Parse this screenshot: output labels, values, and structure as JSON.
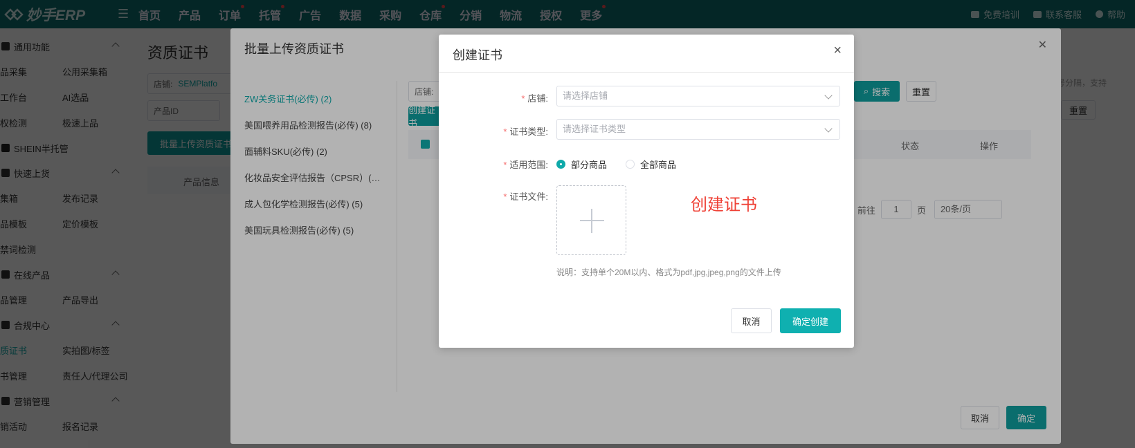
{
  "topbar": {
    "logo_text": "妙手ERP",
    "nav": [
      {
        "label": "首页",
        "dot": false
      },
      {
        "label": "产品",
        "dot": false
      },
      {
        "label": "订单",
        "dot": true
      },
      {
        "label": "托管",
        "dot": true
      },
      {
        "label": "广告",
        "dot": false
      },
      {
        "label": "数据",
        "dot": false
      },
      {
        "label": "采购",
        "dot": false
      },
      {
        "label": "仓库",
        "dot": true
      },
      {
        "label": "分销",
        "dot": false
      },
      {
        "label": "物流",
        "dot": false
      },
      {
        "label": "授权",
        "dot": false
      },
      {
        "label": "更多",
        "dot": true
      }
    ],
    "free_training": "免费培训",
    "contact_service": "联系客服",
    "help": "帮助"
  },
  "sidebar": {
    "general": "通用功能",
    "row1": [
      "品采集",
      "公用采集箱"
    ],
    "row2": [
      "工作台",
      "AI选品"
    ],
    "row3": [
      "权检测",
      "极速上品"
    ],
    "shein": "SHEIN半托管",
    "quick": "快速上货",
    "row4": [
      "集箱",
      "发布记录"
    ],
    "row5": [
      "品模板",
      "定价模板"
    ],
    "row6": [
      "禁词检测"
    ],
    "online": "在线产品",
    "row7": [
      "品管理",
      "产品导出"
    ],
    "compliance": "合规中心",
    "row8": [
      "质证书",
      "实拍图/标签"
    ],
    "row9": [
      "书管理",
      "责任人/代理公司"
    ],
    "marketing": "营销管理",
    "row10": [
      "销活动",
      "报名记录"
    ]
  },
  "main": {
    "title": "资质证书",
    "store_label": "店铺:",
    "store_value": "SEMPlatfo",
    "product_id": "产品ID",
    "batch_upload_btn": "批量上传资质证书",
    "product_info": "产品信息",
    "right_hint": "用逗号分隔，支持",
    "reset": "重置"
  },
  "batch_modal": {
    "title": "批量上传资质证书",
    "cert_list": [
      "ZW关务证书(必传) (2)",
      "美国喂养用品检测报告(必传) (8)",
      "面辅料SKU(必传) (2)",
      "化妆品安全评估报告（CPSR）(必传)",
      "成人包化学检测报告(必传) (5)",
      "美国玩具检测报告(必传) (5)"
    ],
    "store_label": "店铺:",
    "create_btn": "创建证书",
    "search_btn": "搜索",
    "reset_btn": "重置",
    "col_status": "状态",
    "col_action": "操作",
    "pager_current": "1",
    "pager_goto": "前往",
    "pager_page_value": "1",
    "pager_page_unit": "页",
    "pager_size": "20条/页",
    "cancel": "取消",
    "confirm": "确定"
  },
  "dialog": {
    "title": "创建证书",
    "store_label": "店铺:",
    "store_placeholder": "请选择店铺",
    "type_label": "证书类型:",
    "type_placeholder": "请选择证书类型",
    "scope_label": "适用范围:",
    "scope_partial": "部分商品",
    "scope_all": "全部商品",
    "file_label": "证书文件:",
    "annotation": "创建证书",
    "hint": "说明：支持单个20M以内、格式为pdf,jpg,jpeg,png的文件上传",
    "cancel": "取消",
    "confirm": "确定创建"
  },
  "colors": {
    "accent": "#0fa9a9",
    "topbar": "#0f6e6e",
    "required": "#f56c6c",
    "annotation": "#ef4136"
  }
}
